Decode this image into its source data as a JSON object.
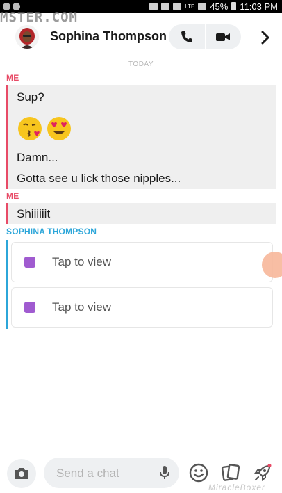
{
  "status_bar": {
    "network": "LTE",
    "battery": "45%",
    "time": "11:03 PM"
  },
  "watermark_top": "MSTER.COM",
  "header": {
    "contact_name": "Sophina Thompson"
  },
  "date_separator": "TODAY",
  "messages": [
    {
      "sender": "ME",
      "lines": [
        "Sup?",
        "😘😍",
        "Damn...",
        "Gotta see u lick those nipples..."
      ]
    },
    {
      "sender": "ME",
      "lines": [
        "Shiiiiiit"
      ]
    },
    {
      "sender": "SOPHINA THOMPSON",
      "snaps": [
        "Tap to view",
        "Tap to view"
      ]
    }
  ],
  "composer": {
    "placeholder": "Send a chat"
  },
  "watermark_bottom": "MiracleBoxer",
  "colors": {
    "me": "#e84b67",
    "them": "#2ca6d9",
    "snap": "#a05bd0"
  }
}
